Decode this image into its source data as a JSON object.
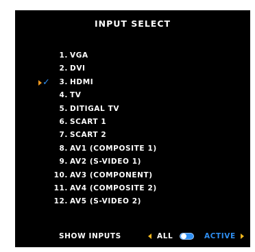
{
  "menu": {
    "title": "INPUT SELECT",
    "selected_index": 2,
    "items": [
      {
        "number": "1.",
        "label": "VGA"
      },
      {
        "number": "2.",
        "label": "DVI"
      },
      {
        "number": "3.",
        "label": "HDMI"
      },
      {
        "number": "4.",
        "label": "TV"
      },
      {
        "number": "5.",
        "label": "DITIGAL TV"
      },
      {
        "number": "6.",
        "label": "SCART 1"
      },
      {
        "number": "7.",
        "label": "SCART 2"
      },
      {
        "number": "8.",
        "label": "AV1 (COMPOSITE 1)"
      },
      {
        "number": "9.",
        "label": "AV2 (S-VIDEO 1)"
      },
      {
        "number": "10.",
        "label": "AV3 (COMPONENT)"
      },
      {
        "number": "11.",
        "label": "AV4 (COMPOSITE 2)"
      },
      {
        "number": "12.",
        "label": "AV5 (S-VIDEO 2)"
      }
    ],
    "selection_indicator": {
      "arrow_icon": "play-arrow-icon",
      "check_icon": "checkmark-icon",
      "check_glyph": "✓"
    }
  },
  "footer": {
    "show_inputs_label": "SHOW INPUTS",
    "option_all": "ALL",
    "option_active": "ACTIVE",
    "current_option": "ACTIVE"
  },
  "colors": {
    "background": "#000000",
    "text": "#ffffff",
    "accent_blue": "#2f8ff2",
    "accent_orange": "#f39a1e",
    "arrow_yellow": "#f2b81f"
  }
}
